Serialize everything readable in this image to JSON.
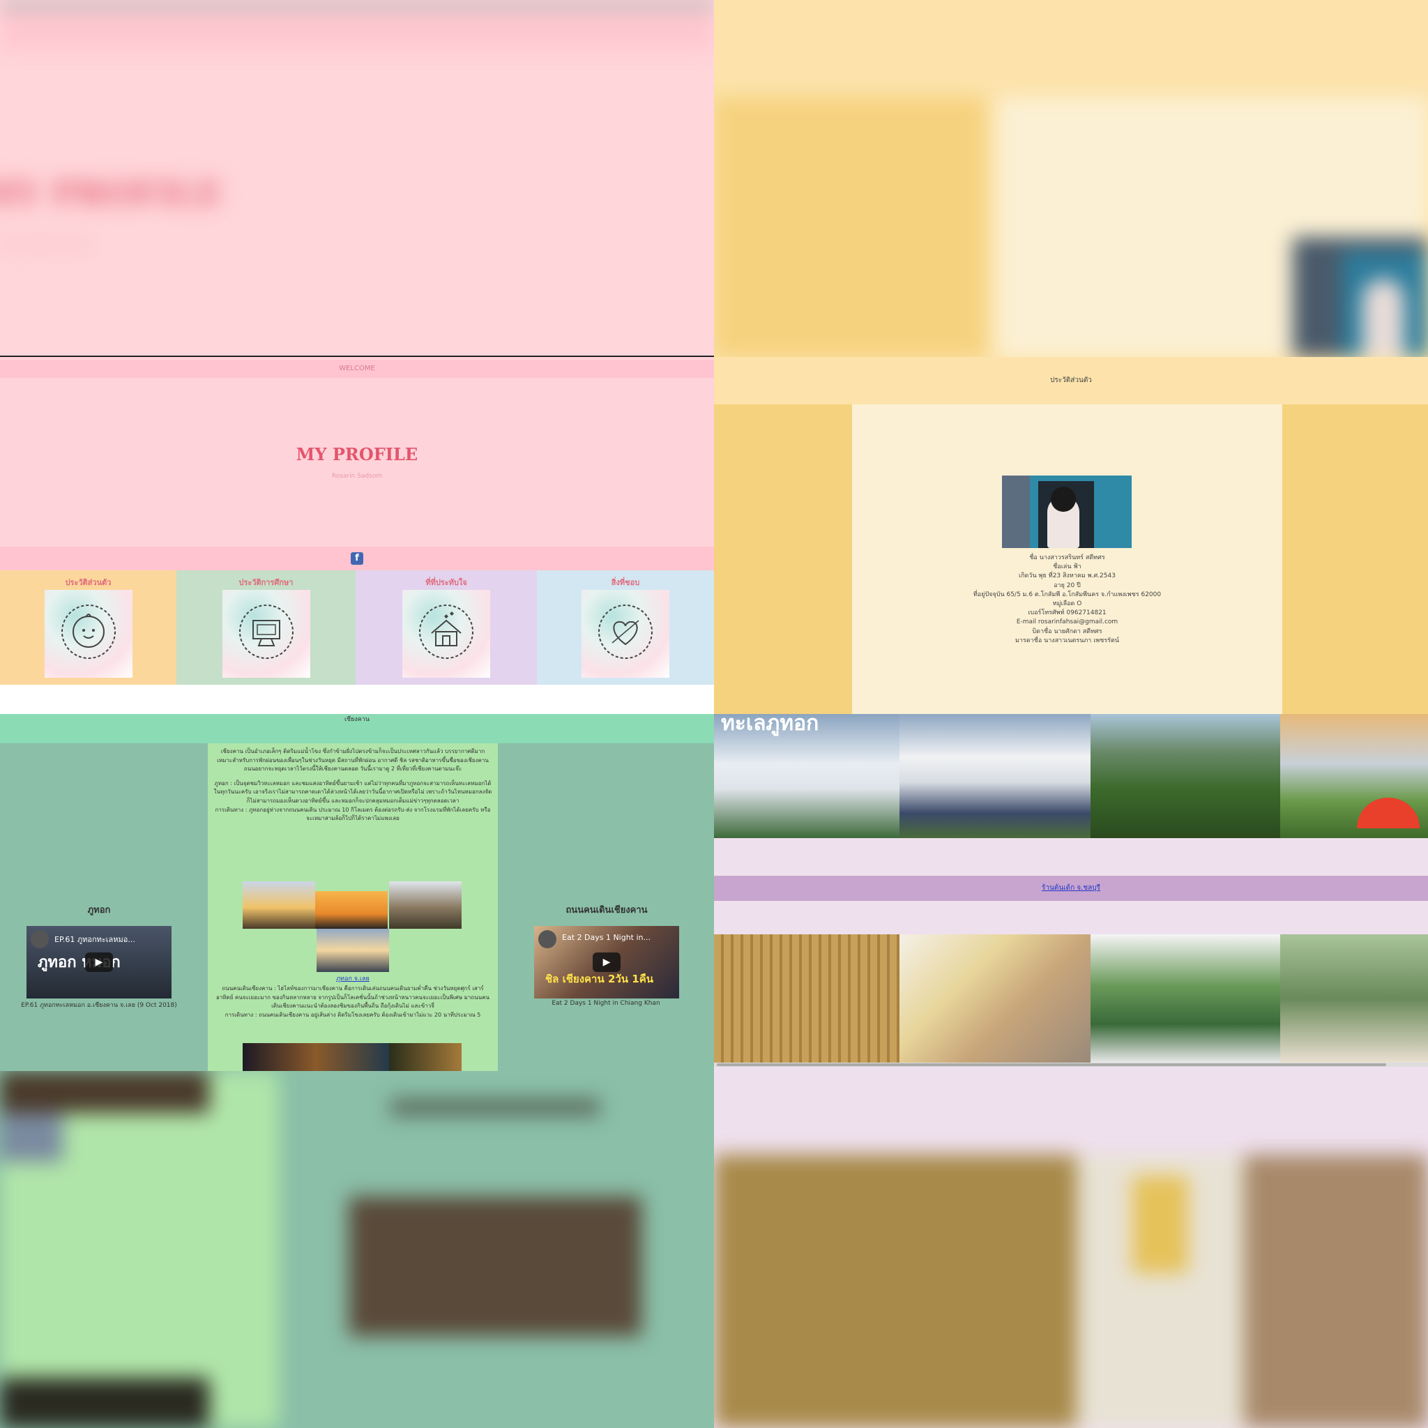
{
  "profile": {
    "welcome": "WELCOME",
    "title": "MY PROFILE",
    "subtitle": "Rosarin Sadsom",
    "facebook_label": "f",
    "tiles": [
      {
        "label": "ประวัติส่วนตัว",
        "icon": "baby-face-icon",
        "color": "#fcd79c"
      },
      {
        "label": "ประวัติการศึกษา",
        "icon": "computer-icon",
        "color": "#c5dfc8"
      },
      {
        "label": "ที่ที่ประทับใจ",
        "icon": "house-icon",
        "color": "#e3d3ee"
      },
      {
        "label": "สิ่งที่ชอบ",
        "icon": "heart-icon",
        "color": "#d3e7f3"
      }
    ]
  },
  "personal": {
    "title": "ประวัติส่วนตัว",
    "lines": [
      "ชื่อ นางสาวรสรินทร์ สดีทศร",
      "ชื่อเล่น ฟ้า",
      "เกิดวัน พุธ ที่23 สิงหาคม พ.ศ.2543",
      "อายุ 20 ปี",
      "ที่อยู่ปัจจุบัน 65/5 ม.6 ต.โกสัมพี อ.โกสัมพีนคร จ.กำแพงเพชร 62000",
      "หมู่เลือด O",
      "เบอร์โทรศัพท์ 0962714821",
      "E-mail rosarinfahsai@gmail.com",
      "บิดาชื่อ นายศักดา สดีทศร",
      "มารดาชื่อ นางสาวเนตรนภา เพชรรัตน์"
    ]
  },
  "chiangkhan": {
    "header": "เชียงคาน",
    "paragraphs": [
      "เชียงคาน เป็นอำเภอเล็กๆ ติดริมแม่น้ำโขง ซึ่งกำข้ามฝั่งไปตรงข้ามก็จะเป็นประเทศลาวกันแล้ว บรรยากาศดีมากเหมาะสำหรับการพักผ่อนของเพื่อนๆในช่วงวันหยุด มีสถานที่พักผ่อน อากาศดี ชิล รสชาติอาหารขึ้นชื่อของเชียงคาน ถนนอยากจะหยุดเวลาไว้ตรงนี้ให้เชียงคานตลอด วันนี้เรามาดู 2 ที่เที่ยวที่เชียงคานตามนะจ๊ะ",
      "ภูทอก : เป็นจุดชมวิวทะเลหมอก และชมแสงอาทิตย์ขึ้นยามเช้า แต่ไม่ว่าทุกคนที่มาภูทอกจะสามารถเห็นทะเลหมอกได้ในทุกวันนะครับ เอาจริงเราไม่สามารถคาดเดาได้ล่วงหน้าได้เลยว่าวันนี้อากาศเปิดหรือไม่ เพราะถ้าวันไหนหมอกลงจัดก็ไม่สามารถมองเห็นดวงอาทิตย์ขึ้น และหมอกก็จะปกคลุมหมอกเต็มแม่ข่าวๆทุกตลอดเวลา",
      "การเดินทาง : ภูทอกอยู่ห่างจากถนนคนเดิน ประมาณ 10 กิโลเมตร ต้องต่อรถรับ-ส่ง จากโรงแรมที่พักได้เลยครับ หรือจะเหมาสามล้อก็ไปก็ได้ราคาไม่แพงเลย",
      "ภูทอก จ.เลย",
      "ถนนคนเดินเชียงคาน : ไฮไลท์ของการมาเชียงคาน คือการเดินเล่นถนนคนเดินยามค่ำคืน ช่วงวันหยุดศุกร์ เสาร์ อาทิตย์ คนจะเยอะมาก ของกินหลากหลาย จากรูปเป็นก็โลเคชั่นนั้นถ้าช่วงหน้าหนาวคนจะเยอะเป็นพิเศษ มาถนนคนเดินเชียงคานแนะนำต้องลองชิมของกินพื้นถิ่น ถือกุ้งเดินไม่ และข้าวจี่",
      "การเดินทาง : ถนนคนเดินเชียงคาน อยู่เส้นล่าง ติดริมโขงเลยครับ ต้องเดินเข้ามาไม่แวะ 20 นาทีประมาณ 5"
    ],
    "left_title": "ภูทอก",
    "left_video_title": "EP.61 ภูทอกทะเลหมอ...",
    "left_video_overlay": "ภูทอก หมอก",
    "left_caption": "EP.61 ภูทอกทะเลหมอก อ.เชียงคาน จ.เลย (9 Oct 2018)",
    "right_title": "ถนนคนเดินเชียงคาน",
    "right_video_title": "Eat 2 Days 1 Night in...",
    "right_video_overlay": "ชิล เชียงคาน 2วัน 1คืน",
    "right_caption": "Eat 2 Days 1 Night in Chiang Khan"
  },
  "gallery": {
    "top_banner_text": "ทะเลภูทอก",
    "cafe_link": "ร้านต้นเด้ก จ.ชลบุรี"
  },
  "colors": {
    "pink": "#ffd3da",
    "yellow": "#f5d27e",
    "mint": "#8bbfa8",
    "lavender": "#efe0ee"
  }
}
